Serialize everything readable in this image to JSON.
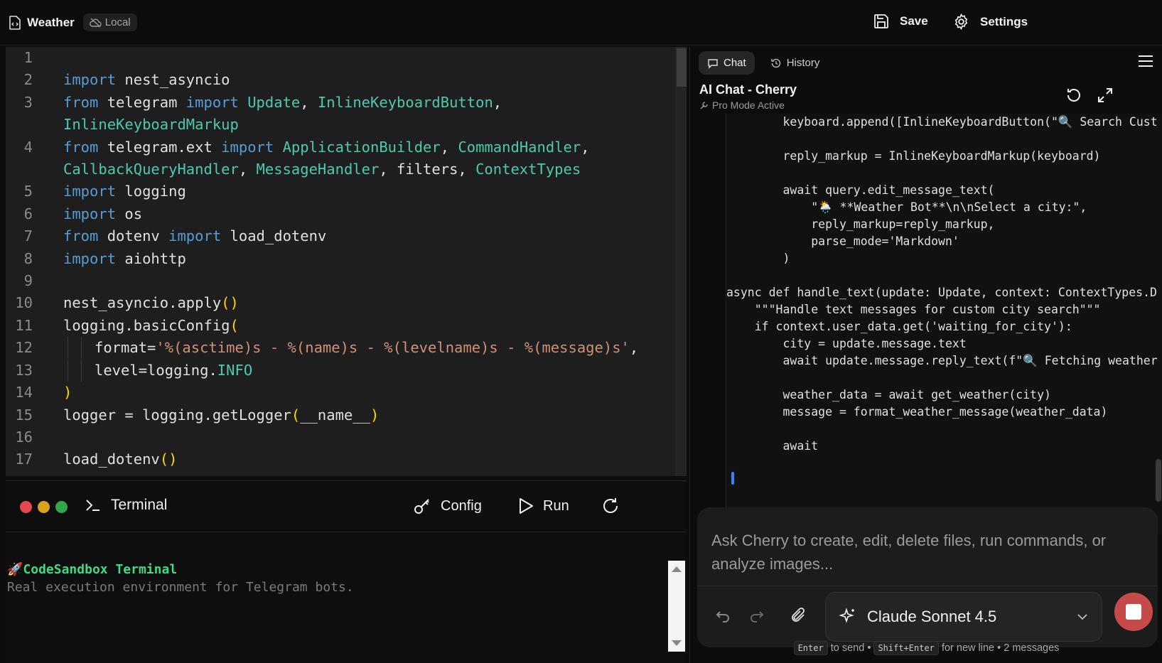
{
  "topbar": {
    "title": "Weather",
    "badge": "Local",
    "save_label": "Save",
    "settings_label": "Settings"
  },
  "editor": {
    "lines": [
      {
        "n": "1"
      },
      {
        "n": "2"
      },
      {
        "n": "3"
      },
      {
        "n": "4"
      },
      {
        "n": "5"
      },
      {
        "n": "6"
      },
      {
        "n": "7"
      },
      {
        "n": "8"
      },
      {
        "n": "9"
      },
      {
        "n": "10"
      },
      {
        "n": "11"
      },
      {
        "n": "12"
      },
      {
        "n": "13"
      },
      {
        "n": "14"
      },
      {
        "n": "15"
      },
      {
        "n": "16"
      },
      {
        "n": "17"
      }
    ],
    "code": {
      "l2": [
        "import",
        " nest_asyncio"
      ],
      "l3": [
        "from",
        " telegram ",
        "import",
        " ",
        "Update",
        ", ",
        "InlineKeyboardButton",
        ","
      ],
      "l3b": [
        "InlineKeyboardMarkup"
      ],
      "l4": [
        "from",
        " telegram.ext ",
        "import",
        " ",
        "ApplicationBuilder",
        ", ",
        "CommandHandler",
        ","
      ],
      "l4b": [
        "CallbackQueryHandler",
        ", ",
        "MessageHandler",
        ", filters, ",
        "ContextTypes"
      ],
      "l5": [
        "import",
        " logging"
      ],
      "l6": [
        "import",
        " os"
      ],
      "l7": [
        "from",
        " dotenv ",
        "import",
        " load_dotenv"
      ],
      "l8": [
        "import",
        " aiohttp"
      ],
      "l10": [
        "nest_asyncio.apply",
        "()"
      ],
      "l11": [
        "logging.basicConfig",
        "("
      ],
      "l12": [
        "format=",
        "'%(asctime)s - %(name)s - %(levelname)s - %(message)s'",
        ","
      ],
      "l13": [
        "level=logging.",
        "INFO"
      ],
      "l14": [
        ")"
      ],
      "l15": [
        "logger = logging.getLogger",
        "(",
        "__name__",
        ")"
      ],
      "l17": [
        "load_dotenv",
        "()"
      ]
    }
  },
  "terminal": {
    "title": "Terminal",
    "config_label": "Config",
    "run_label": "Run",
    "output_line1": "🚀CodeSandbox Terminal",
    "output_line2": "Real execution environment for Telegram bots."
  },
  "chat": {
    "tab_chat": "Chat",
    "tab_history": "History",
    "title": "AI Chat - Cherry",
    "mode": "Pro Mode Active",
    "code_lines": [
      "        keyboard.append([InlineKeyboardButton(\"🔍 Search Cust",
      "",
      "        reply_markup = InlineKeyboardMarkup(keyboard)",
      "",
      "        await query.edit_message_text(",
      "            \"🌦️ **Weather Bot**\\n\\nSelect a city:\",",
      "            reply_markup=reply_markup,",
      "            parse_mode='Markdown'",
      "        )",
      "",
      "async def handle_text(update: Update, context: ContextTypes.D",
      "    \"\"\"Handle text messages for custom city search\"\"\"",
      "    if context.user_data.get('waiting_for_city'):",
      "        city = update.message.text",
      "        await update.message.reply_text(f\"🔍 Fetching weather",
      "",
      "        weather_data = await get_weather(city)",
      "        message = format_weather_message(weather_data)",
      "",
      "        await"
    ],
    "placeholder": "Ask Cherry to create, edit, delete files, run commands, or analyze images...",
    "model": "Claude Sonnet 4.5",
    "hint_enter": "Enter",
    "hint_send": "to send •",
    "hint_shift": "Shift+Enter",
    "hint_newline": "for new line • 2 messages"
  },
  "colors": {
    "accent_stop": "#c74a4a",
    "terminal_green": "#3ddc84",
    "keyword": "#569cd6",
    "class": "#4ec9b0",
    "string": "#ce9178"
  }
}
